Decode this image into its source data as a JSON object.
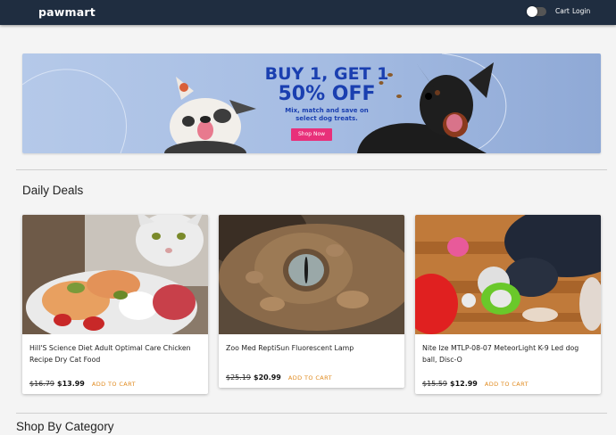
{
  "navbar": {
    "brand": "pawmart",
    "cart": "Cart",
    "login": "Login"
  },
  "banner": {
    "headline1": "BUY 1, GET 1",
    "headline2": "50% OFF",
    "subline1": "Mix, match and save on",
    "subline2": "select dog treats.",
    "cta": "Shop Now"
  },
  "sections": {
    "daily_deals": "Daily Deals",
    "shop_by_category": "Shop By Category"
  },
  "products": [
    {
      "title": "Hill'S Science Diet Adult Optimal Care Chicken Recipe Dry Cat Food",
      "old_price": "$16.79",
      "price": "$13.99",
      "cta": "ADD TO CART"
    },
    {
      "title": "Zoo Med ReptiSun Fluorescent Lamp",
      "old_price": "$25.19",
      "price": "$20.99",
      "cta": "ADD TO CART"
    },
    {
      "title": "Nite Ize MTLP-08-07 MeteorLight K-9 Led dog ball, Disc-O",
      "old_price": "$15.59",
      "price": "$12.99",
      "cta": "ADD TO CART"
    }
  ],
  "colors": {
    "navbar": "#1f2d40",
    "banner_text": "#1a3fb0",
    "cta": "#e8307a",
    "add_to_cart": "#e08a1e"
  }
}
